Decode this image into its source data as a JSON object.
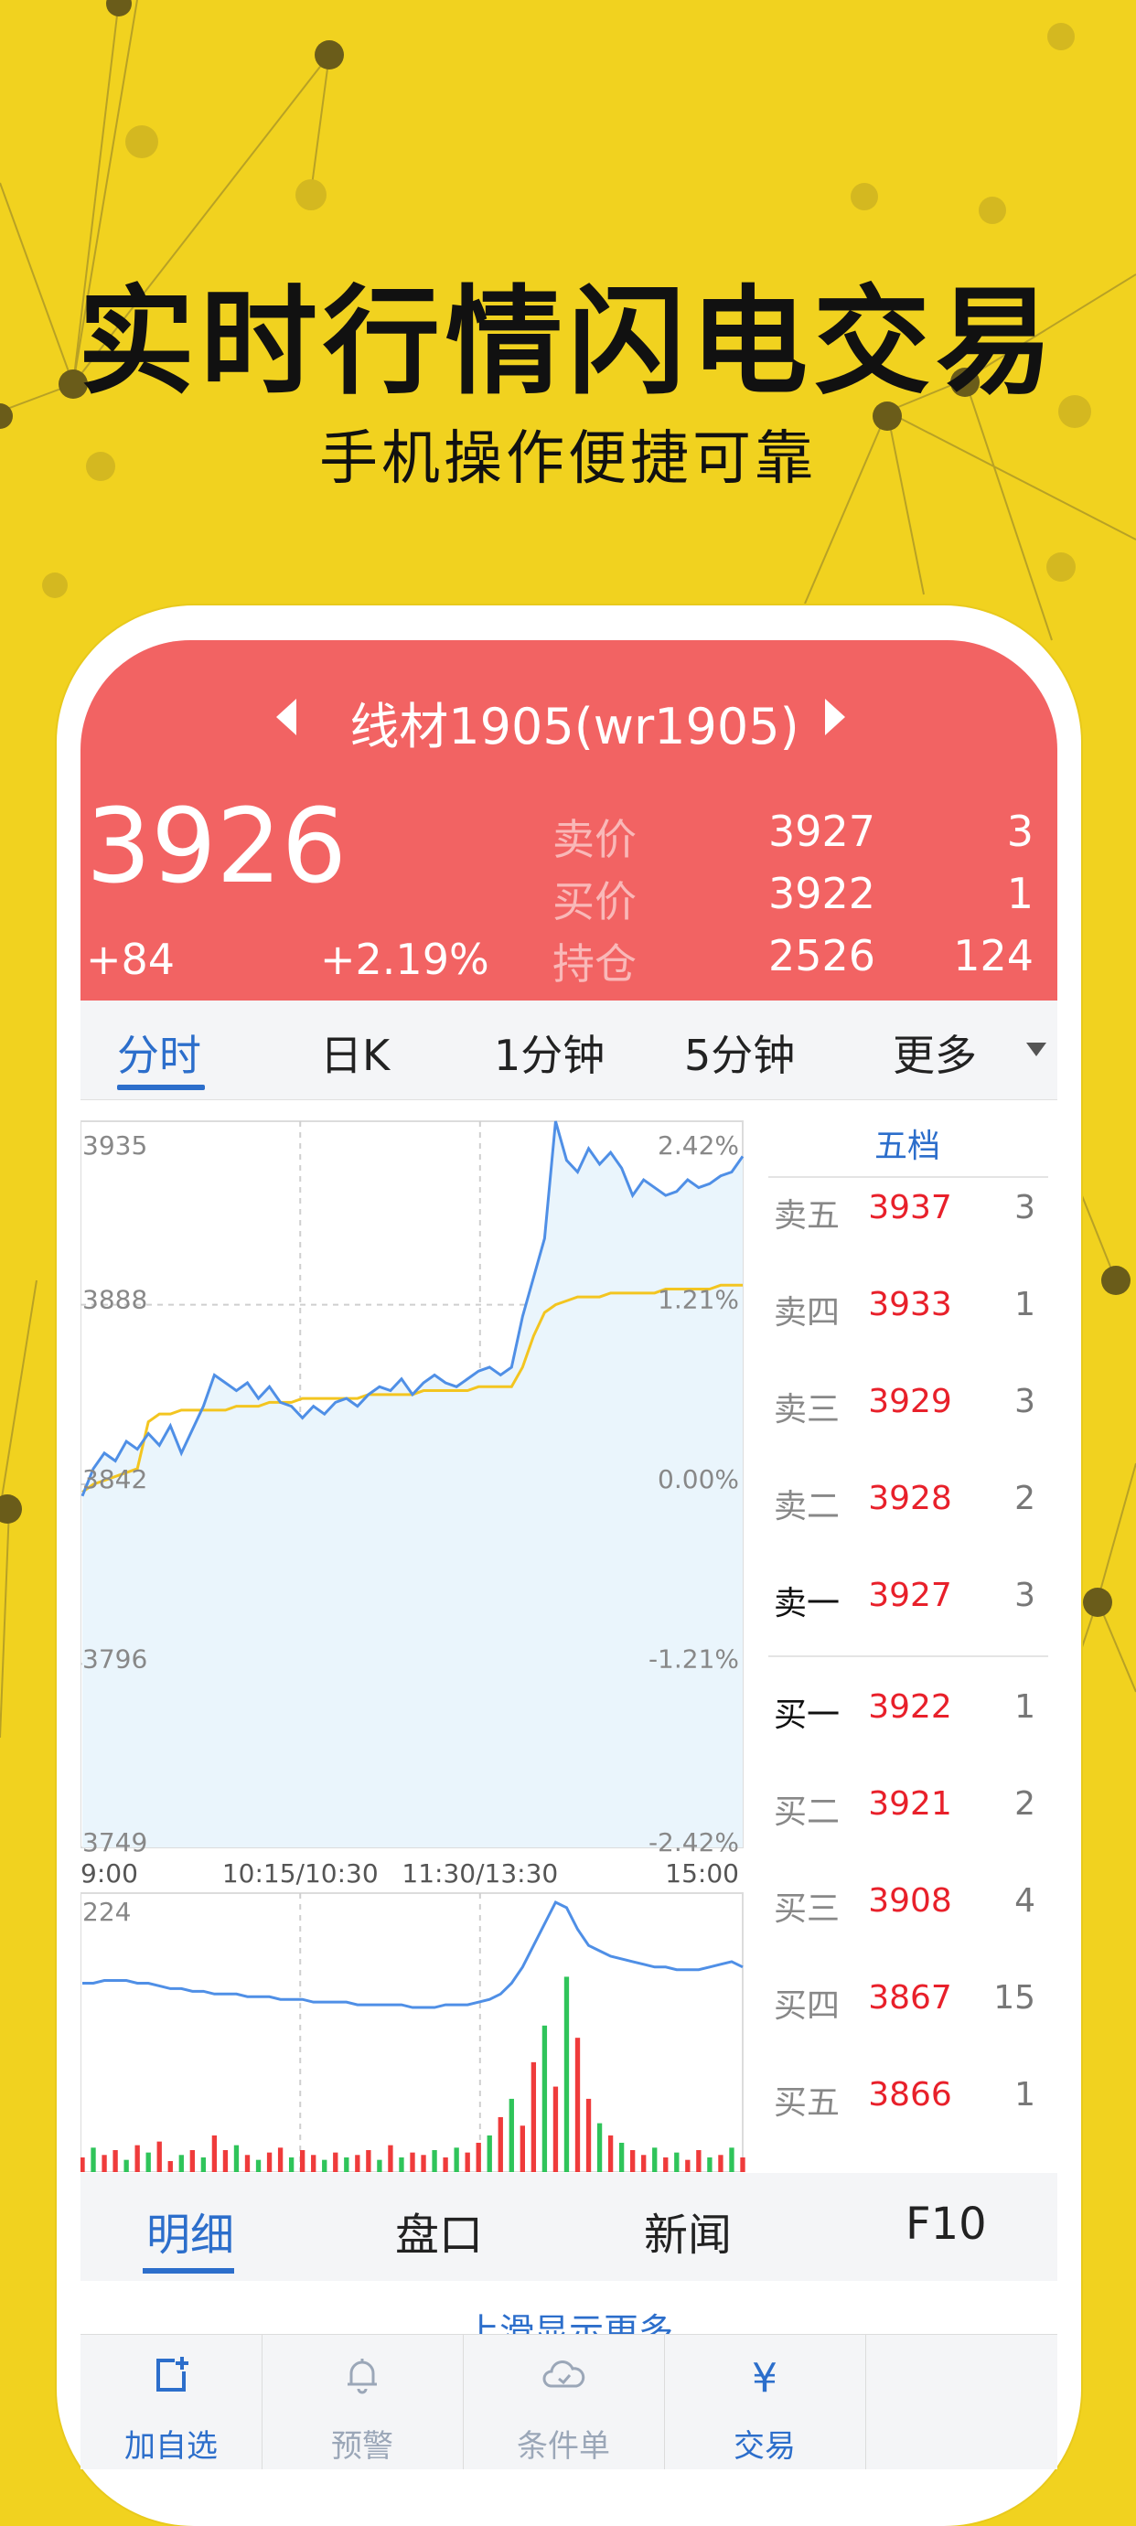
{
  "promo": {
    "headline": "实时行情闪电交易",
    "subline": "手机操作便捷可靠"
  },
  "colors": {
    "background": "#f1d21f",
    "header": "#f26363",
    "accent": "#2c6ecb",
    "price_red": "#e8202a",
    "price_line": "#4f8fe6",
    "avg_line": "#f3c520",
    "vol_up": "#ef3b3b",
    "vol_down": "#2fc45a"
  },
  "quote": {
    "contract": "线材1905(wr1905)",
    "last_price": "3926",
    "change": "+84",
    "change_pct": "+2.19%",
    "rows": [
      {
        "label": "卖价",
        "value": "3927",
        "qty": "3"
      },
      {
        "label": "买价",
        "value": "3922",
        "qty": "1"
      },
      {
        "label": "持仓",
        "value": "2526",
        "qty": "124"
      }
    ]
  },
  "tabs": [
    "分时",
    "日K",
    "1分钟",
    "5分钟",
    "更多"
  ],
  "chart_data": {
    "type": "line",
    "price_axis_left": [
      "3935",
      "3888",
      "3842",
      "3796",
      "3749"
    ],
    "price_axis_right": [
      "2.42%",
      "1.21%",
      "0.00%",
      "-1.21%",
      "-2.42%"
    ],
    "time_labels": [
      "9:00",
      "10:15/10:30",
      "11:30/13:30",
      "15:00"
    ],
    "volume_axis_max": "224",
    "ylim": [
      3749,
      3935
    ],
    "price": [
      3839,
      3846,
      3850,
      3848,
      3853,
      3851,
      3855,
      3852,
      3857,
      3850,
      3856,
      3862,
      3870,
      3868,
      3866,
      3868,
      3864,
      3867,
      3863,
      3862,
      3859,
      3862,
      3860,
      3863,
      3864,
      3862,
      3865,
      3867,
      3866,
      3869,
      3865,
      3868,
      3870,
      3868,
      3867,
      3869,
      3871,
      3872,
      3870,
      3872,
      3885,
      3895,
      3905,
      3935,
      3925,
      3922,
      3928,
      3924,
      3927,
      3923,
      3916,
      3920,
      3918,
      3916,
      3917,
      3920,
      3918,
      3919,
      3921,
      3922,
      3926
    ],
    "avg": [
      3840,
      3842,
      3843,
      3844,
      3845,
      3846,
      3858,
      3860,
      3860,
      3861,
      3861,
      3861,
      3861,
      3861,
      3862,
      3862,
      3862,
      3863,
      3863,
      3863,
      3864,
      3864,
      3864,
      3864,
      3864,
      3864,
      3865,
      3865,
      3865,
      3865,
      3865,
      3866,
      3866,
      3866,
      3866,
      3866,
      3867,
      3867,
      3867,
      3867,
      3872,
      3880,
      3886,
      3888,
      3889,
      3890,
      3890,
      3890,
      3891,
      3891,
      3891,
      3891,
      3891,
      3892,
      3892,
      3892,
      3892,
      3892,
      3893,
      3893,
      3893
    ],
    "volume": [
      12,
      20,
      14,
      18,
      10,
      22,
      16,
      25,
      9,
      14,
      18,
      12,
      30,
      18,
      22,
      14,
      10,
      16,
      20,
      12,
      18,
      14,
      10,
      16,
      12,
      14,
      18,
      10,
      22,
      12,
      16,
      14,
      18,
      12,
      20,
      16,
      24,
      30,
      45,
      60,
      38,
      90,
      120,
      70,
      160,
      110,
      60,
      40,
      30,
      24,
      18,
      14,
      20,
      12,
      16,
      10,
      18,
      12,
      14,
      20,
      12
    ],
    "volume_up": [
      true,
      false,
      true,
      true,
      false,
      true,
      false,
      true,
      true,
      false,
      true,
      false,
      true,
      true,
      false,
      true,
      false,
      true,
      true,
      false,
      true,
      true,
      false,
      true,
      false,
      true,
      true,
      false,
      true,
      false,
      true,
      true,
      false,
      true,
      false,
      true,
      true,
      false,
      true,
      false,
      true,
      true,
      false,
      true,
      false,
      true,
      true,
      false,
      true,
      false,
      true,
      true,
      false,
      true,
      false,
      true,
      true,
      false,
      true,
      false,
      true
    ],
    "open_interest": [
      0.7,
      0.7,
      0.71,
      0.71,
      0.71,
      0.7,
      0.7,
      0.69,
      0.68,
      0.68,
      0.67,
      0.67,
      0.66,
      0.66,
      0.66,
      0.65,
      0.65,
      0.65,
      0.64,
      0.64,
      0.64,
      0.63,
      0.63,
      0.63,
      0.63,
      0.62,
      0.62,
      0.62,
      0.62,
      0.62,
      0.61,
      0.61,
      0.61,
      0.62,
      0.62,
      0.62,
      0.63,
      0.64,
      0.66,
      0.7,
      0.76,
      0.84,
      0.92,
      1.0,
      0.98,
      0.9,
      0.84,
      0.82,
      0.8,
      0.79,
      0.78,
      0.77,
      0.76,
      0.76,
      0.75,
      0.75,
      0.75,
      0.76,
      0.77,
      0.78,
      0.76
    ]
  },
  "orderbook": {
    "title": "五档",
    "asks": [
      {
        "label": "卖五",
        "price": "3937",
        "qty": "3"
      },
      {
        "label": "卖四",
        "price": "3933",
        "qty": "1"
      },
      {
        "label": "卖三",
        "price": "3929",
        "qty": "3"
      },
      {
        "label": "卖二",
        "price": "3928",
        "qty": "2"
      },
      {
        "label": "卖一",
        "price": "3927",
        "qty": "3"
      }
    ],
    "bids": [
      {
        "label": "买一",
        "price": "3922",
        "qty": "1"
      },
      {
        "label": "买二",
        "price": "3921",
        "qty": "2"
      },
      {
        "label": "买三",
        "price": "3908",
        "qty": "4"
      },
      {
        "label": "买四",
        "price": "3867",
        "qty": "15"
      },
      {
        "label": "买五",
        "price": "3866",
        "qty": "1"
      }
    ]
  },
  "bottom_tabs": [
    "明细",
    "盘口",
    "新闻",
    "F10"
  ],
  "swipe_hint": "上滑显示更多",
  "toolbar": [
    {
      "label": "加自选",
      "icon": "add-watchlist-icon"
    },
    {
      "label": "预警",
      "icon": "bell-icon"
    },
    {
      "label": "条件单",
      "icon": "cloud-icon"
    },
    {
      "label": "交易",
      "icon": "yen-icon"
    }
  ]
}
